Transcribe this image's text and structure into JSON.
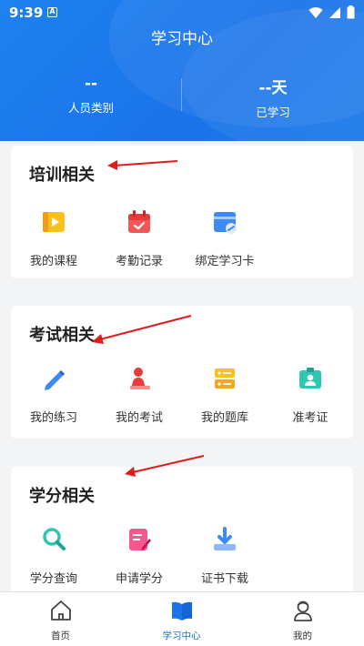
{
  "status": {
    "time": "9:39",
    "badge": "A"
  },
  "header": {
    "title": "学习中心",
    "stats": [
      {
        "value": "--",
        "label": "人员类别"
      },
      {
        "value": "--天",
        "label": "已学习"
      }
    ]
  },
  "sections": [
    {
      "title": "培训相关",
      "items": [
        {
          "label": "我的课程",
          "icon": "video-icon"
        },
        {
          "label": "考勤记录",
          "icon": "calendar-icon"
        },
        {
          "label": "绑定学习卡",
          "icon": "card-link-icon"
        }
      ]
    },
    {
      "title": "考试相关",
      "items": [
        {
          "label": "我的练习",
          "icon": "pencil-icon"
        },
        {
          "label": "我的考试",
          "icon": "exam-person-icon"
        },
        {
          "label": "我的题库",
          "icon": "database-icon"
        },
        {
          "label": "准考证",
          "icon": "id-card-icon"
        }
      ]
    },
    {
      "title": "学分相关",
      "items": [
        {
          "label": "学分查询",
          "icon": "search-icon"
        },
        {
          "label": "申请学分",
          "icon": "edit-form-icon"
        },
        {
          "label": "证书下载",
          "icon": "download-icon"
        }
      ]
    }
  ],
  "tabs": [
    {
      "label": "首页",
      "icon": "home-icon",
      "active": false
    },
    {
      "label": "学习中心",
      "icon": "book-icon",
      "active": true
    },
    {
      "label": "我的",
      "icon": "user-icon",
      "active": false
    }
  ],
  "colors": {
    "primary": "#1a73e8",
    "arrow": "#e01b1b"
  }
}
